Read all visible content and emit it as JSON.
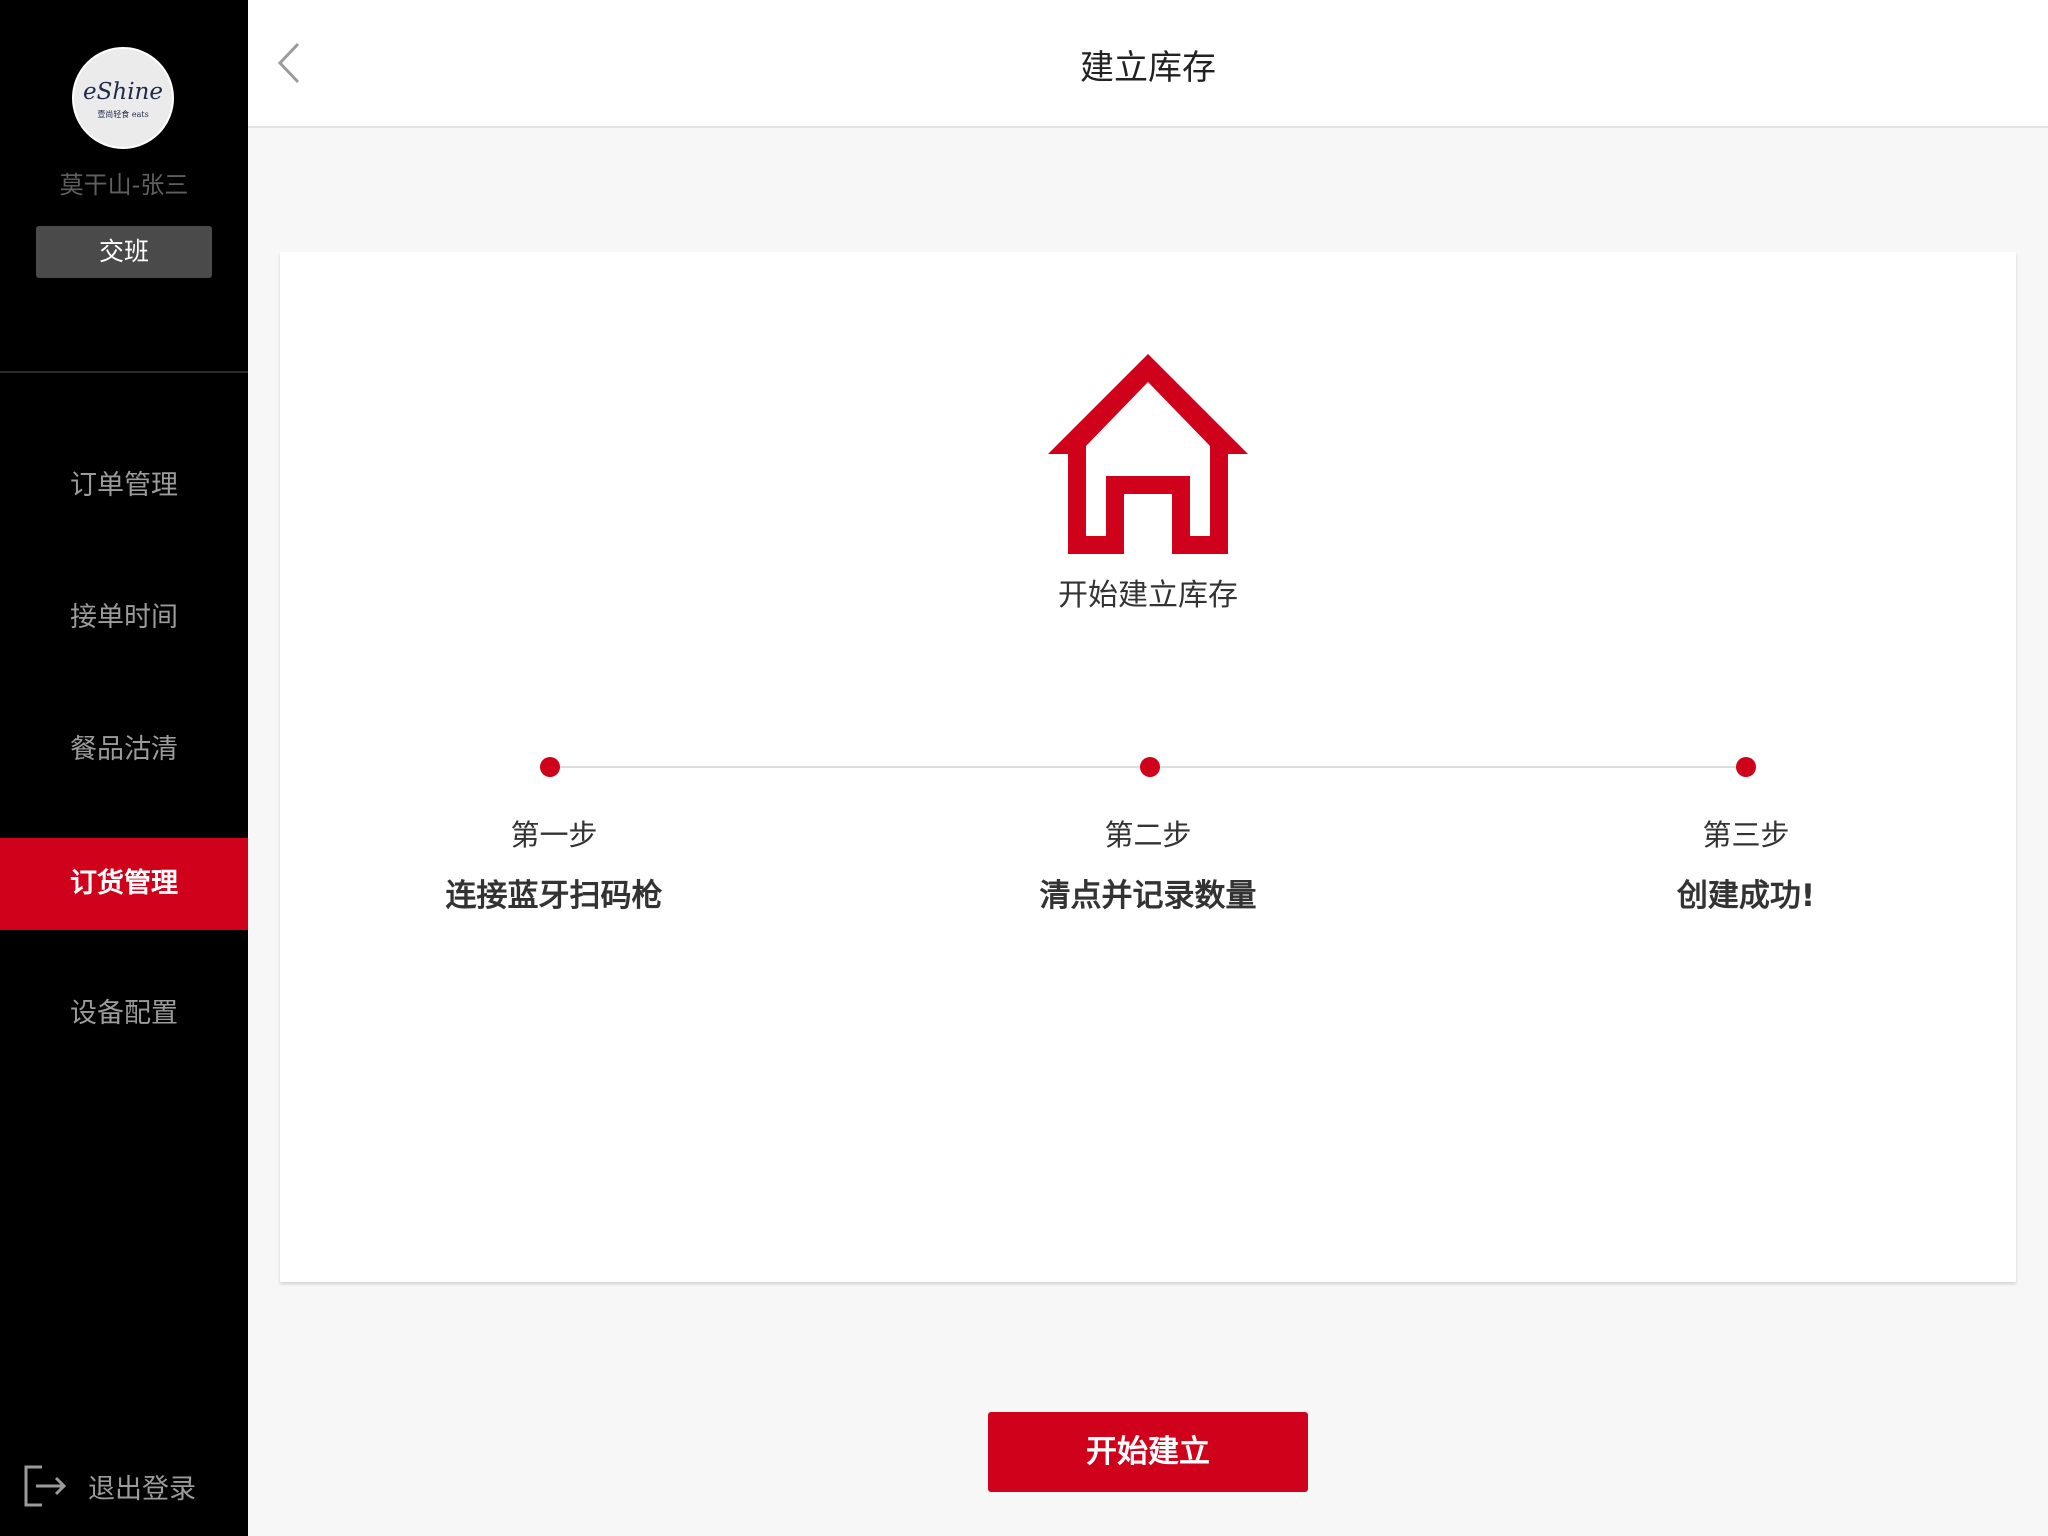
{
  "sidebar": {
    "logo_text": "eShine",
    "logo_subtext": "壹尚轻食 eats",
    "user_name": "莫干山-张三",
    "shift_button": "交班",
    "nav": [
      {
        "label": "订单管理",
        "active": false
      },
      {
        "label": "接单时间",
        "active": false
      },
      {
        "label": "餐品沽清",
        "active": false
      },
      {
        "label": "订货管理",
        "active": true
      },
      {
        "label": "设备配置",
        "active": false
      }
    ],
    "logout_label": "退出登录",
    "logout_icon": "logout-icon"
  },
  "header": {
    "title": "建立库存",
    "back_icon": "chevron-left-icon"
  },
  "main": {
    "icon": "house-icon",
    "heading": "开始建立库存",
    "steps": [
      {
        "label": "第一步",
        "desc": "连接蓝牙扫码枪"
      },
      {
        "label": "第二步",
        "desc": "清点并记录数量"
      },
      {
        "label": "第三步",
        "desc": "创建成功!"
      }
    ],
    "start_button": "开始建立"
  },
  "colors": {
    "accent": "#d0021b",
    "sidebar_bg": "#000000",
    "page_bg": "#f7f7f7"
  }
}
